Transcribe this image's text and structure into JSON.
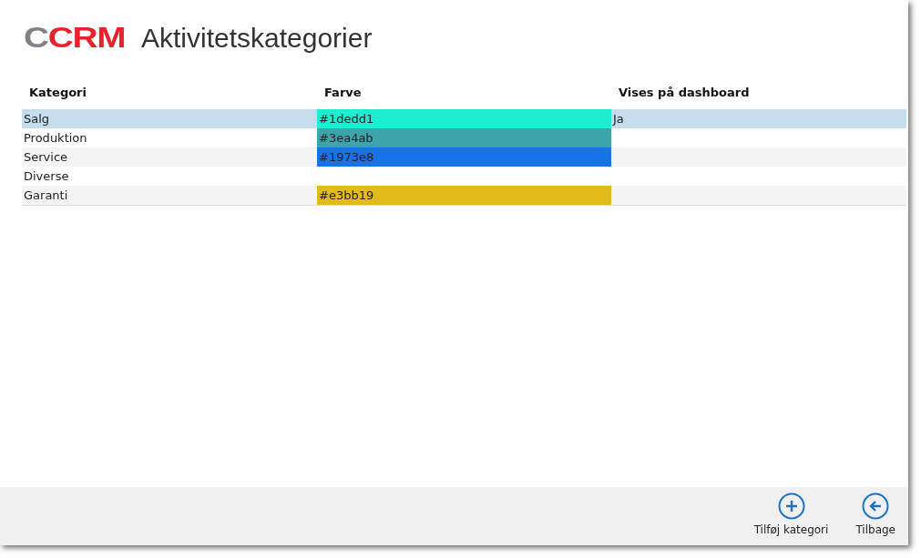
{
  "header": {
    "logo": [
      {
        "text": "C",
        "color": "#808285"
      },
      {
        "text": "CRM",
        "color": "#e8222e"
      }
    ],
    "title": "Aktivitetskategorier"
  },
  "table": {
    "columns": [
      "Kategori",
      "Farve",
      "Vises på dashboard"
    ],
    "rows": [
      {
        "category": "Salg",
        "color_code": "#1dedd1",
        "color": "#1dedd1",
        "dashboard": "Ja",
        "selected": true
      },
      {
        "category": "Produktion",
        "color_code": "#3ea4ab",
        "color": "#3ea4ab",
        "selected": false
      },
      {
        "category": "Service",
        "color_code": "#1973e8",
        "color": "#1973e8",
        "selected": false
      },
      {
        "category": "Diverse",
        "selected": false
      },
      {
        "category": "Garanti",
        "color_code": "#e3bb19",
        "color": "#e3bb19",
        "selected": false
      }
    ]
  },
  "app_bar": {
    "buttons": [
      {
        "kind": "add",
        "label": "Tilføj kategori"
      },
      {
        "kind": "back",
        "label": "Tilbage"
      }
    ]
  }
}
